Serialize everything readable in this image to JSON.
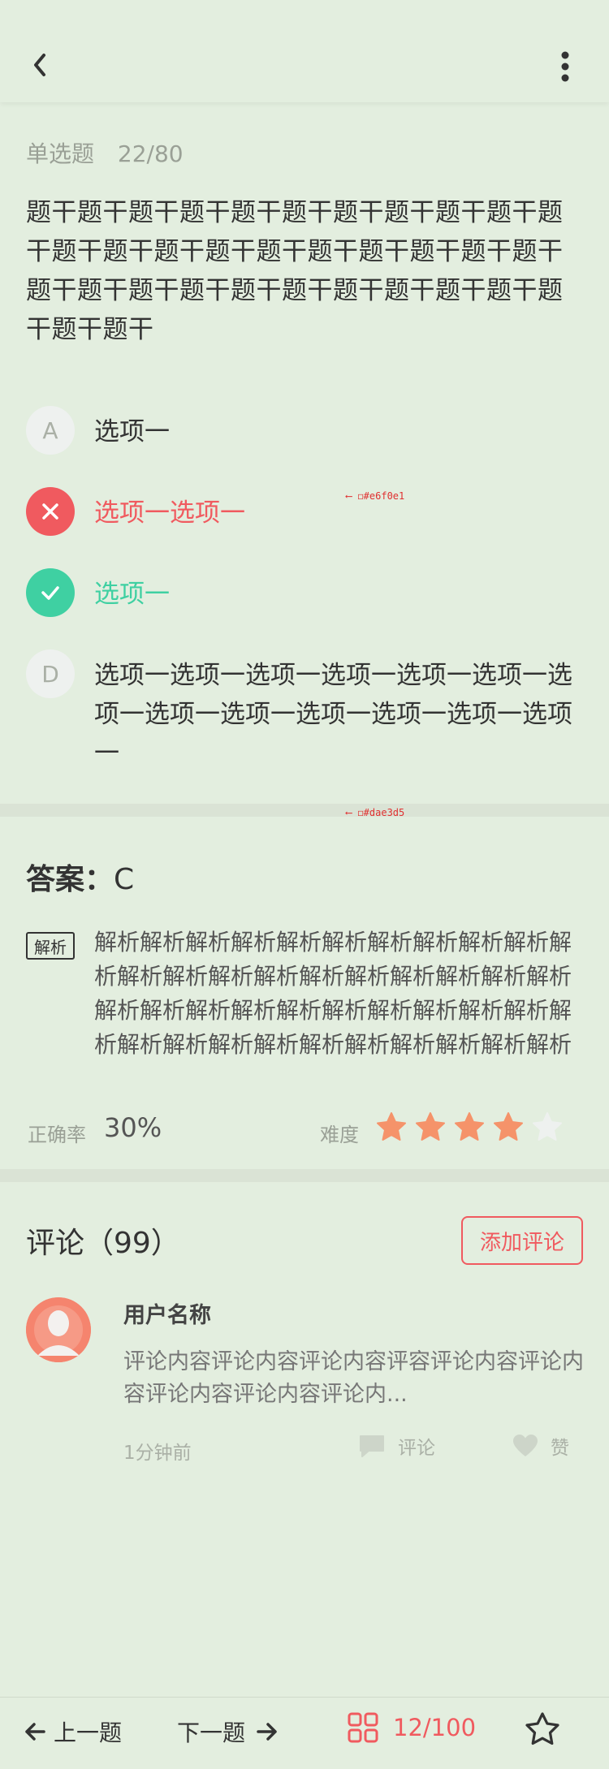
{
  "question": {
    "type": "单选题",
    "number": "22/80",
    "stem": "题干题干题干题干题干题干题干题干题干题干题干题干题干题干题干题干题干题干题干题干题干题干题干题干题干题干题干题干题干题干题干题干题干题干"
  },
  "options": [
    {
      "letter": "A",
      "text": "选项一",
      "state": "normal"
    },
    {
      "letter": "B",
      "text": "选项一选项一",
      "state": "wrong"
    },
    {
      "letter": "C",
      "text": "选项一",
      "state": "right"
    },
    {
      "letter": "D",
      "text": "选项一选项一选项一选项一选项一选项一选项一选项一选项一选项一选项一选项一选项一",
      "state": "normal"
    }
  ],
  "annotations": {
    "wrong_bg": "⟵ ◻#e6f0e1",
    "divider_color": "⟵ ◻#dae3d5"
  },
  "answer": {
    "label": "答案：",
    "value": "C"
  },
  "analysis": {
    "tag": "解析",
    "text": "解析解析解析解析解析解析解析解析解析解析解析解析解析解析解析解析解析解析解析解析解析解析解析解析解析解析解析解析解析解析解析解析解析解析解析解析解析解析解析解析解析解析"
  },
  "stats": {
    "rate_label": "正确率",
    "rate_value": "30%",
    "difficulty_label": "难度",
    "difficulty": 4,
    "difficulty_max": 5
  },
  "comments": {
    "title": "评论（99）",
    "add_label": "添加评论",
    "items": [
      {
        "username": "用户名称",
        "text": "评论内容评论内容评论内容评容评论内容评论内容评论内容评论内容评论内...",
        "time": "1分钟前",
        "reply_label": "评论",
        "like_label": "赞"
      }
    ]
  },
  "bottom_bar": {
    "prev_label": "上一题",
    "next_label": "下一题",
    "progress": "12/100"
  },
  "colors": {
    "background": "#e3eedf",
    "divider": "#dae3d5",
    "wrong": "#f05a5f",
    "right": "#3fd0a2",
    "star": "#f5936a",
    "star_empty": "#eef1ef"
  },
  "icons": {
    "back": "chevron-left-icon",
    "more": "more-vertical-icon",
    "wrong": "close-icon",
    "right": "check-icon",
    "star": "star-icon",
    "reply": "chat-bubble-icon",
    "like": "heart-icon",
    "grid": "grid-icon",
    "favorite": "star-outline-icon"
  }
}
